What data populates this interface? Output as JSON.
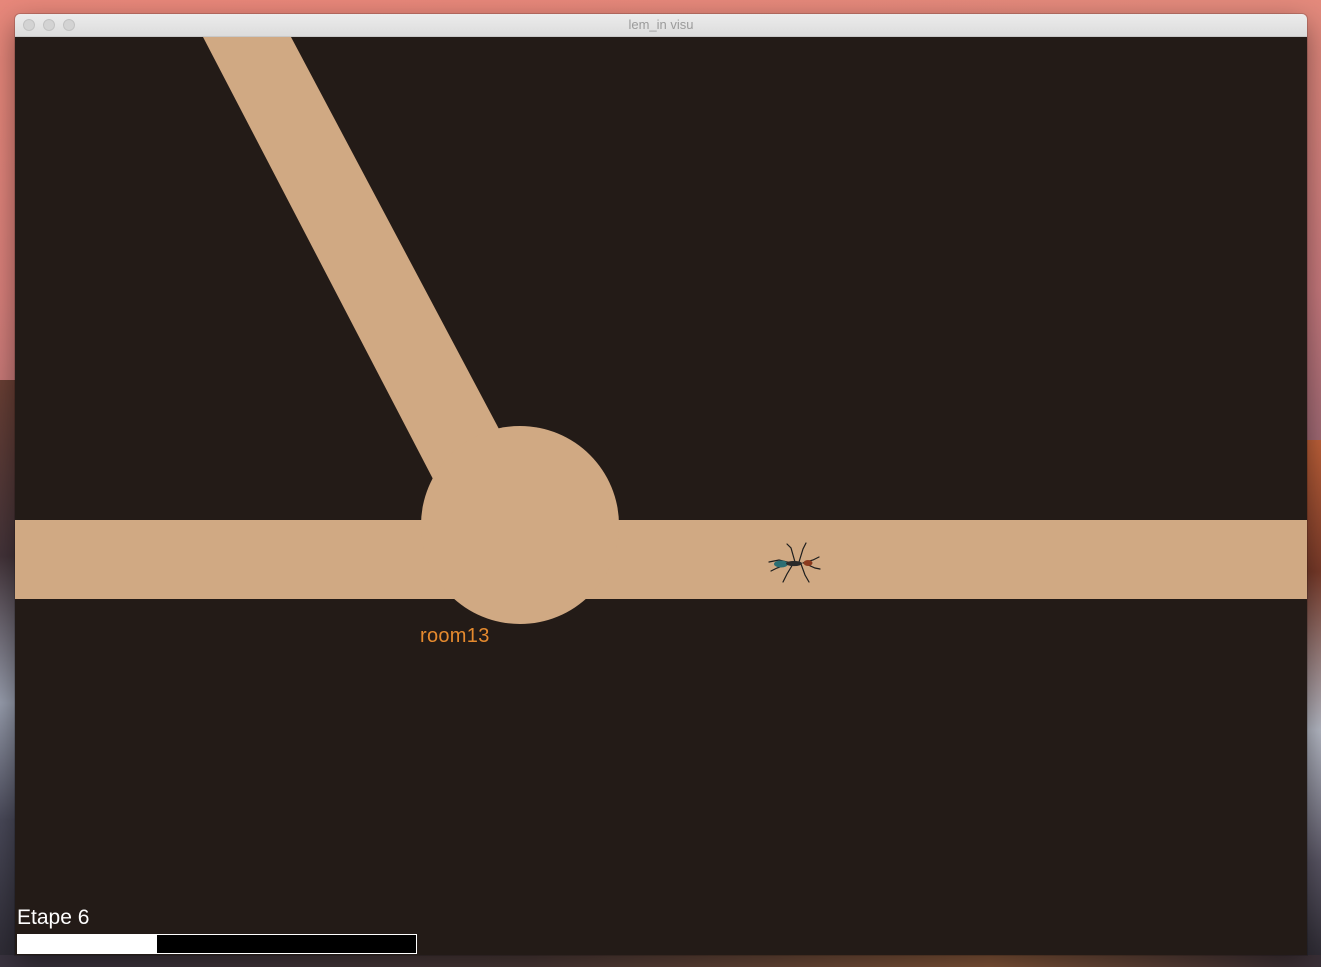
{
  "window": {
    "title": "lem_in visu"
  },
  "scene": {
    "background_color": "#231b17",
    "tube_color": "#d0a983",
    "room": {
      "label": "room13",
      "label_color": "#e58a2e"
    },
    "ant": {
      "icon": "ant-icon"
    }
  },
  "footer": {
    "step_label": "Etape 6",
    "progress": {
      "fraction": 0.35
    }
  }
}
